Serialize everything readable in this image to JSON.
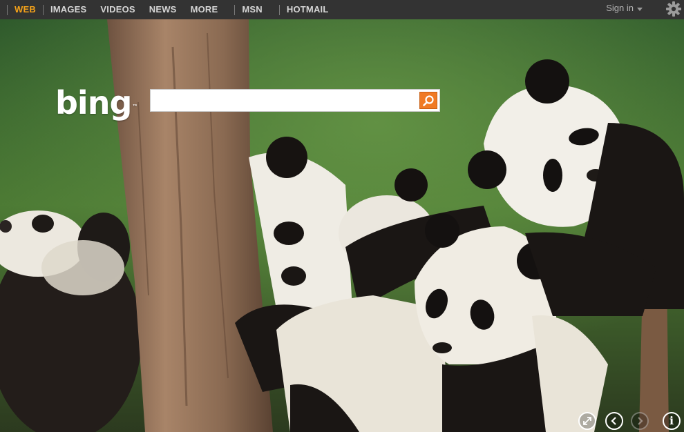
{
  "nav": {
    "items": [
      {
        "label": "WEB",
        "active": true
      },
      {
        "label": "IMAGES"
      },
      {
        "label": "VIDEOS"
      },
      {
        "label": "NEWS"
      },
      {
        "label": "MORE"
      },
      {
        "label": "MSN"
      },
      {
        "label": "HOTMAIL"
      }
    ],
    "signin_label": "Sign in",
    "settings_icon": "gear-icon"
  },
  "logo": {
    "text": "bing",
    "trademark": "™"
  },
  "search": {
    "value": "",
    "placeholder": "",
    "button_icon": "search-icon"
  },
  "controls": [
    {
      "name": "fullscreen-button",
      "icon": "expand-icon",
      "disabled": false
    },
    {
      "name": "previous-image-button",
      "icon": "chevron-left-icon",
      "disabled": false
    },
    {
      "name": "next-image-button",
      "icon": "chevron-right-icon",
      "disabled": true
    },
    {
      "name": "info-button",
      "icon": "info-icon",
      "glyph": "i",
      "disabled": false
    }
  ],
  "colors": {
    "nav_bar": "#333333",
    "nav_active": "#f4a21a",
    "nav_text": "#d6d6d6",
    "search_button": "#f07a24"
  }
}
